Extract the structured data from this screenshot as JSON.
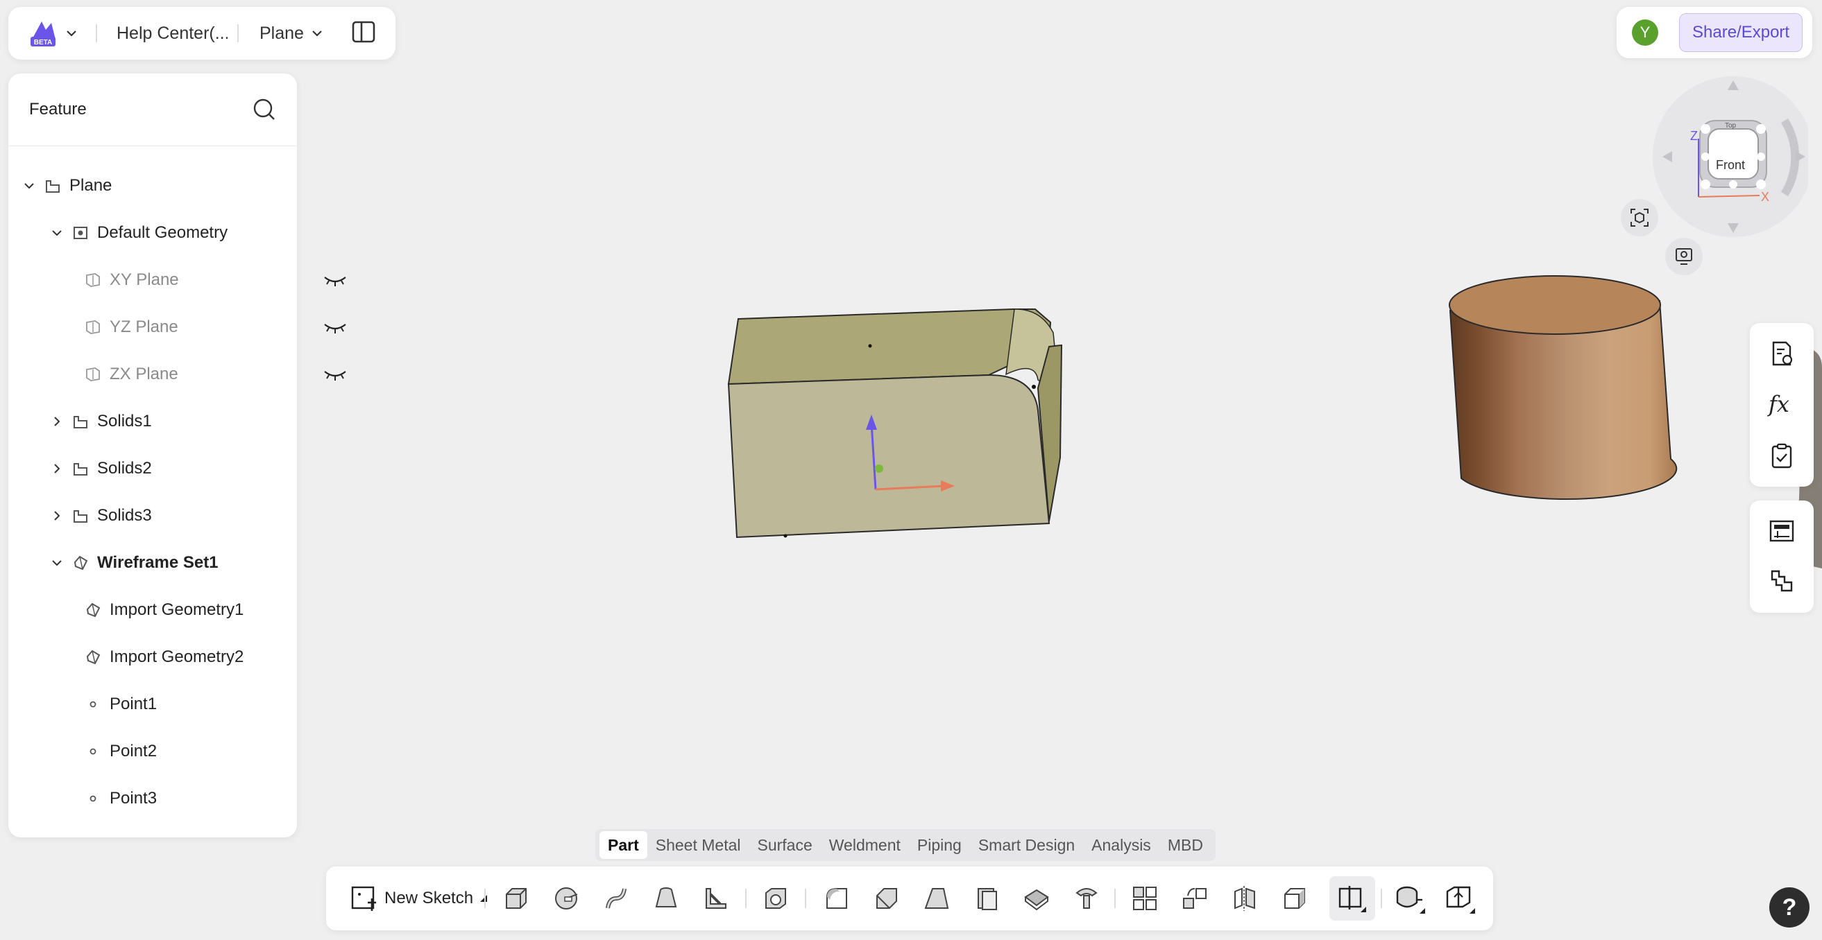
{
  "topbar": {
    "logo_badge": "BETA",
    "document_title": "Help Center(...",
    "part_name": "Plane"
  },
  "feature_panel": {
    "title": "Feature",
    "tree": [
      {
        "label": "Plane",
        "icon": "part-icon",
        "expanded": true
      },
      {
        "label": "Default Geometry",
        "icon": "geometry-icon",
        "expanded": true
      },
      {
        "label": "XY Plane",
        "icon": "plane-icon",
        "hidden": true
      },
      {
        "label": "YZ Plane",
        "icon": "plane-icon",
        "hidden": true
      },
      {
        "label": "ZX Plane",
        "icon": "plane-icon",
        "hidden": true
      },
      {
        "label": "Solids1",
        "icon": "solid-icon",
        "expanded": false
      },
      {
        "label": "Solids2",
        "icon": "solid-icon",
        "expanded": false
      },
      {
        "label": "Solids3",
        "icon": "solid-icon",
        "expanded": false
      },
      {
        "label": "Wireframe Set1",
        "icon": "wireframe-icon",
        "expanded": true
      },
      {
        "label": "Import Geometry1",
        "icon": "import-geometry-icon"
      },
      {
        "label": "Import Geometry2",
        "icon": "import-geometry-icon"
      },
      {
        "label": "Point1",
        "icon": "point-icon"
      },
      {
        "label": "Point2",
        "icon": "point-icon"
      },
      {
        "label": "Point3",
        "icon": "point-icon"
      }
    ]
  },
  "share": {
    "avatar_letter": "Y",
    "button_label": "Share/Export"
  },
  "navcube": {
    "front_label": "Front",
    "top_label": "Top",
    "axis_z": "Z",
    "axis_x": "X"
  },
  "bottom_tabs": [
    "Part",
    "Sheet Metal",
    "Surface",
    "Weldment",
    "Piping",
    "Smart Design",
    "Analysis",
    "MBD"
  ],
  "active_tab": "Part",
  "toolbar": {
    "new_sketch_label": "New Sketch"
  },
  "help_label": "?",
  "colors": {
    "accent": "#5a4bd1",
    "box_top": "#aba776",
    "box_front": "#bcb898",
    "cylinder_top": "#b6865a",
    "avatar": "#5aa02c"
  }
}
